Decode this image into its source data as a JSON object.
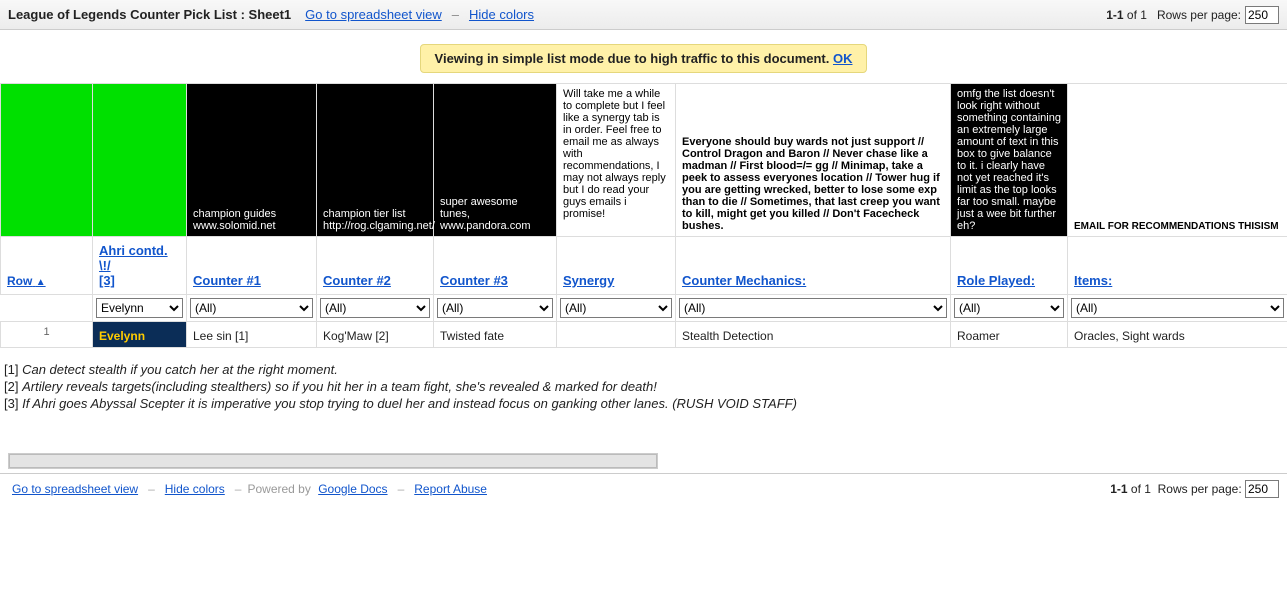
{
  "topbar": {
    "title": "League of Legends Counter Pick List : Sheet1",
    "go_link": "Go to spreadsheet view",
    "hide_link": "Hide colors",
    "paging": "1-1",
    "paging_of": " of 1",
    "rpp_label": "Rows per page:",
    "rpp_value": "250"
  },
  "notice": {
    "text": "Viewing in simple list mode due to high traffic to this document. ",
    "ok": "OK"
  },
  "infocells": {
    "c1": "champion guides www.solomid.net",
    "c2": "champion tier list http://rog.clgaming.net/",
    "c3": "super awesome tunes, www.pandora.com",
    "synergy_note": "Will take me a while to complete but I feel like a synergy tab is in order. Feel free to email me as always with recommendations, I may not always reply but I do read your guys emails i promise!",
    "mechanics_note": "Everyone should buy wards not just support // Control Dragon and Baron // Never chase like a madman // First blood=/= gg // Minimap, take a peek to assess everyones location // Tower hug if you are getting wrecked, better to lose some exp than to die // Sometimes, that last creep you want to kill, might get you killed // Don't Facecheck bushes.",
    "role_note": "omfg the list doesn't look right without something containing an extremely large amount of text in this box to give balance to it. i clearly have not yet reached it's limit as the top looks far too small. maybe just a wee bit further eh?",
    "items_note": "EMAIL FOR RECOMMENDATIONS THISISM"
  },
  "headers": {
    "row": "Row",
    "champ": "Ahri contd. \\!/",
    "champ_sub": "[3]",
    "counter1": "Counter #1",
    "counter2": "Counter #2",
    "counter3": "Counter #3",
    "synergy": "Synergy",
    "mechanics": "Counter Mechanics:",
    "role": "Role Played:",
    "items": "Items:"
  },
  "filters": {
    "champ": "Evelynn",
    "all": "(All)"
  },
  "row": {
    "num": "1",
    "champ": "Evelynn",
    "counter1": "Lee sin  [1]",
    "counter2": "Kog'Maw  [2]",
    "counter3": "Twisted fate",
    "synergy": "",
    "mechanics": "Stealth Detection",
    "role": "Roamer",
    "items": "Oracles, Sight wards"
  },
  "footnotes": {
    "n1": "Can detect stealth if you catch her at the right moment.",
    "n2": "Artilery reveals targets(including stealthers) so if you hit her in a team fight, she's revealed & marked for death!",
    "n3": "If Ahri goes Abyssal Scepter it is imperative you stop trying to duel her and instead focus on ganking other lanes. (RUSH VOID STAFF)"
  },
  "footer": {
    "go_link": "Go to spreadsheet view",
    "hide_link": "Hide colors",
    "powered": "Powered by ",
    "google": "Google Docs",
    "report": "Report Abuse",
    "paging": "1-1",
    "paging_of": " of 1",
    "rpp_label": "Rows per page:",
    "rpp_value": "250"
  }
}
